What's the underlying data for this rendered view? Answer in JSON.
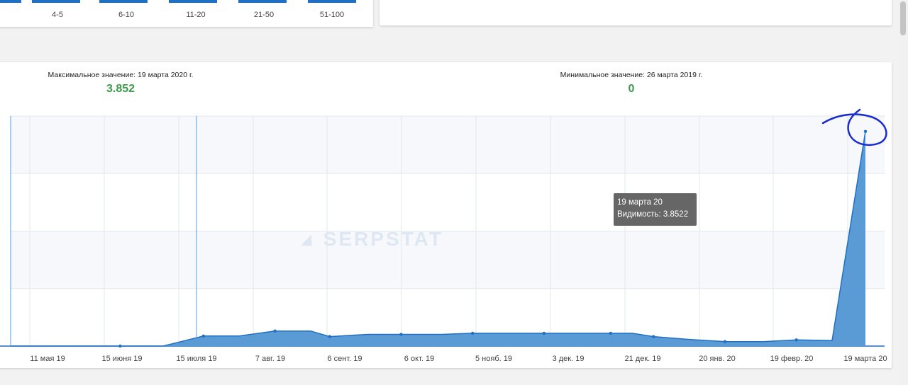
{
  "distribution": {
    "labels": [
      "4-5",
      "6-10",
      "11-20",
      "21-50",
      "51-100"
    ]
  },
  "stats": {
    "max_label": "Максимальное значение: 19 марта 2020 г.",
    "max_value": "3.852",
    "min_label": "Минимальное значение: 26 марта 2019 г.",
    "min_value": "0"
  },
  "watermark": "SERPSTAT",
  "tooltip": {
    "date": "19 марта 20",
    "value": "Видимость: 3.8522"
  },
  "colors": {
    "series": "#1f6fc4",
    "area": "#5b9bd5",
    "value_green": "#3c9a4a",
    "annotation": "#1a2bd0"
  },
  "chart_data": {
    "type": "area",
    "title": "",
    "xlabel": "",
    "ylabel": "",
    "ylim": [
      0,
      4
    ],
    "grid": true,
    "x_ticks": [
      "11 мая 19",
      "15 июня 19",
      "15 июля 19",
      "7 авг. 19",
      "6 сент. 19",
      "6 окт. 19",
      "5 нояб. 19",
      "3 дек. 19",
      "21 дек. 19",
      "20 янв. 20",
      "19 февр. 20",
      "19 марта 20"
    ],
    "series": [
      {
        "x": [
          "2019-03-26",
          "2019-04-23",
          "2019-05-11",
          "2019-05-29",
          "2019-06-15",
          "2019-06-30",
          "2019-07-15",
          "2019-07-30",
          "2019-08-07",
          "2019-08-23",
          "2019-09-06",
          "2019-09-23",
          "2019-10-06",
          "2019-10-23",
          "2019-11-05",
          "2019-11-20",
          "2019-12-03",
          "2019-12-12",
          "2019-12-21",
          "2020-01-05",
          "2020-01-20",
          "2020-02-05",
          "2020-02-19",
          "2020-03-05",
          "2020-03-19"
        ],
        "y": [
          0,
          0,
          0,
          0,
          0.18,
          0.18,
          0.27,
          0.27,
          0.17,
          0.21,
          0.21,
          0.21,
          0.23,
          0.23,
          0.23,
          0.23,
          0.23,
          0.23,
          0.17,
          0.12,
          0.08,
          0.08,
          0.11,
          0.1,
          3.8522
        ],
        "markers": [
          2,
          4,
          6,
          8,
          10,
          12,
          14,
          16,
          18,
          20,
          22,
          24
        ]
      }
    ]
  }
}
